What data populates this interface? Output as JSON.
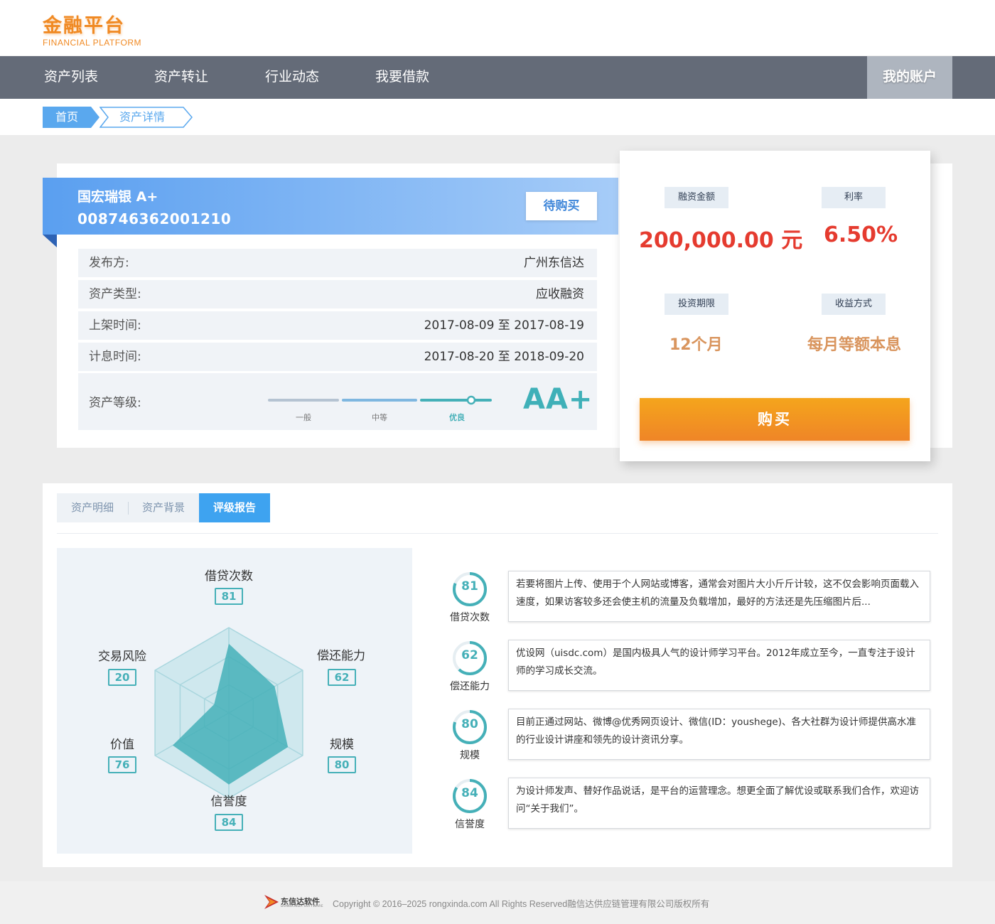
{
  "brand": {
    "name_cn": "金融平台",
    "name_en": "FINANCIAL PLATFORM",
    "accent_color": "#f08a24"
  },
  "nav": {
    "items": [
      "资产列表",
      "资产转让",
      "行业动态",
      "我要借款"
    ],
    "account": "我的账户"
  },
  "breadcrumb": {
    "home": "首页",
    "current": "资产详情"
  },
  "asset": {
    "name": "国宏瑞银  A+",
    "code": "008746362001210",
    "status_button": "待购买",
    "rows": [
      {
        "label": "发布方:",
        "value": "广州东信达"
      },
      {
        "label": "资产类型:",
        "value": "应收融资"
      },
      {
        "label": "上架时间:",
        "value": "2017-08-09 至 2017-08-19"
      },
      {
        "label": "计息时间:",
        "value": "2017-08-20 至 2018-09-20"
      }
    ],
    "grade": {
      "label": "资产等级:",
      "levels": [
        "一般",
        "中等",
        "优良"
      ],
      "current_level": "优良",
      "value": "AA+"
    }
  },
  "summary": {
    "amount_label": "融资金额",
    "amount_value": "200,000.00 元",
    "rate_label": "利率",
    "rate_value": "6.50%",
    "term_label": "投资期限",
    "term_value": "12个月",
    "repay_label": "收益方式",
    "repay_value": "每月等额本息",
    "buy_button": "购买"
  },
  "tabs": {
    "items": [
      "资产明细",
      "资产背景",
      "评级报告"
    ],
    "active": "评级报告"
  },
  "radar": {
    "dimensions": [
      {
        "name": "借贷次数",
        "score": 81
      },
      {
        "name": "偿还能力",
        "score": 62
      },
      {
        "name": "规模",
        "score": 80
      },
      {
        "name": "信誉度",
        "score": 84
      },
      {
        "name": "价值",
        "score": 76
      },
      {
        "name": "交易风险",
        "score": 20
      }
    ]
  },
  "reports": [
    {
      "score": "81",
      "name": "借贷次数",
      "fraction": 0.81,
      "text": "若要将图片上传、使用于个人网站或博客，通常会对图片大小斤斤计较，这不仅会影响页面载入速度，如果访客较多还会使主机的流量及负载增加，最好的方法还是先压缩图片后..."
    },
    {
      "score": "62",
      "name": "偿还能力",
      "fraction": 0.62,
      "text": "优设网（uisdc.com）是国内极具人气的设计师学习平台。2012年成立至今，一直专注于设计师的学习成长交流。"
    },
    {
      "score": "80",
      "name": "规模",
      "fraction": 0.8,
      "text": "目前正通过网站、微博@优秀网页设计、微信(ID：youshege)、各大社群为设计师提供高水准的行业设计讲座和领先的设计资讯分享。"
    },
    {
      "score": "84",
      "name": "信誉度",
      "fraction": 0.84,
      "text": "为设计师发声、替好作品说话，是平台的运营理念。想更全面了解优设或联系我们合作，欢迎访问“关于我们”。"
    }
  ],
  "footer": {
    "logo_cn": "东信达软件",
    "logo_en": "DONGXINDA SOFTWARE",
    "copyright": "Copyright © 2016–2025 rongxinda.com All Rights Reserved融信达供应链管理有限公司版权所有"
  }
}
